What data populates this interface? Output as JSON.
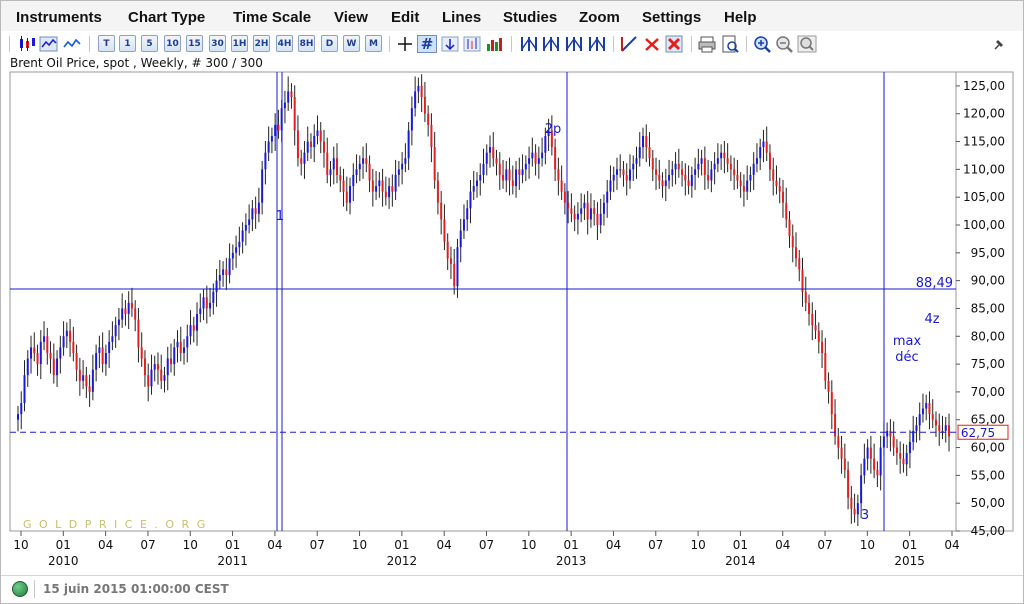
{
  "menu": [
    "Instruments",
    "Chart Type",
    "Time Scale",
    "View",
    "Edit",
    "Lines",
    "Studies",
    "Zoom",
    "Settings",
    "Help"
  ],
  "toolbar": {
    "chart_type_icons": [
      "candlestick-icon",
      "bar-chart-icon",
      "line-chart-icon"
    ],
    "timescale_buttons": [
      "T",
      "1",
      "5",
      "10",
      "15",
      "30",
      "1H",
      "2H",
      "4H",
      "8H",
      "D",
      "W",
      "M"
    ],
    "tool_icons": [
      "crosshair-icon",
      "grid-icon",
      "arrow-down-icon",
      "volume-icon",
      "histogram-icon",
      "cycle-lines-icon-1",
      "cycle-lines-icon-2",
      "cycle-lines-icon-3",
      "cycle-lines-icon-4",
      "draw-line-icon",
      "delete-line-icon",
      "delete-all-icon",
      "print-icon",
      "print-preview-icon",
      "zoom-in-icon",
      "zoom-out-icon",
      "zoom-reset-icon",
      "pin-icon"
    ]
  },
  "chart": {
    "subtitle": "Brent Oil Price, spot , Weekly, # 300 / 300",
    "watermark": "G O L D P R I C E . O R G",
    "annotations": [
      {
        "text": "2p",
        "color": "#1a1ad6"
      },
      {
        "text": "1",
        "color": "#1a1ad6"
      },
      {
        "text": "4z",
        "color": "#1a1ad6"
      },
      {
        "text": "max",
        "color": "#1a1ad6"
      },
      {
        "text": "déc",
        "color": "#1a1ad6"
      },
      {
        "text": "3",
        "color": "#1a1ad6"
      }
    ],
    "hline_label": "88,49",
    "last_price": "62,75"
  },
  "status": {
    "text": "15 juin 2015 01:00:00 CEST"
  },
  "chart_data": {
    "type": "bar",
    "series_name": "",
    "y_axis_side": "right",
    "ylim": [
      45,
      127.5
    ],
    "y_ticks": [
      "45,00",
      "50,00",
      "55,00",
      "60,00",
      "65,00",
      "70,00",
      "75,00",
      "80,00",
      "85,00",
      "90,00",
      "95,00",
      "100,00",
      "105,00",
      "110,00",
      "115,00",
      "120,00",
      "125,00"
    ],
    "x_month_ticks": [
      "10",
      "01",
      "04",
      "07",
      "10",
      "01",
      "04",
      "07",
      "10",
      "01",
      "04",
      "07",
      "10",
      "01",
      "04",
      "07",
      "10",
      "01",
      "04",
      "07",
      "10",
      "01",
      "04"
    ],
    "x_year_labels": [
      "2010",
      "2011",
      "2012",
      "2013",
      "2014",
      "2015"
    ],
    "up_color": "#1a1ad6",
    "down_color": "#e02020",
    "wick_color": "#222222",
    "horizontal_line": {
      "value": 88.49,
      "color": "#1a1ad6",
      "style": "solid"
    },
    "last_price_line": {
      "value": 62.75,
      "color": "#1a1ad6",
      "style": "dashed"
    },
    "vertical_markers": [
      "2011-05 (1)",
      "2011-05",
      "2013-02 (2p)",
      "2015-01 (3)"
    ],
    "weekly_closes": [
      66,
      68,
      73,
      76,
      78,
      77,
      75,
      79,
      80,
      77,
      76,
      73,
      76,
      78,
      80,
      81,
      79,
      77,
      74,
      72,
      73,
      71,
      70,
      74,
      77,
      78,
      75,
      77,
      79,
      80,
      82,
      83,
      85,
      84,
      86,
      85,
      83,
      78,
      76,
      73,
      71,
      74,
      75,
      74,
      72,
      73,
      76,
      75,
      78,
      79,
      77,
      78,
      80,
      82,
      81,
      84,
      85,
      87,
      85,
      86,
      88,
      90,
      91,
      92,
      91,
      94,
      95,
      96,
      97,
      99,
      100,
      101,
      103,
      102,
      104,
      110,
      113,
      115,
      116,
      118,
      117,
      121,
      122,
      124,
      123,
      117,
      112,
      111,
      113,
      115,
      114,
      116,
      117,
      115,
      113,
      109,
      110,
      112,
      109,
      108,
      106,
      104,
      107,
      109,
      110,
      111,
      112,
      111,
      108,
      106,
      107,
      108,
      106,
      105,
      107,
      106,
      109,
      110,
      111,
      112,
      117,
      121,
      124,
      125,
      123,
      120,
      118,
      114,
      108,
      104,
      101,
      97,
      94,
      93,
      89,
      96,
      99,
      101,
      103,
      106,
      107,
      108,
      109,
      111,
      113,
      114,
      112,
      111,
      109,
      108,
      110,
      108,
      107,
      110,
      109,
      110,
      111,
      112,
      113,
      111,
      112,
      113,
      116,
      117,
      114,
      110,
      108,
      106,
      104,
      103,
      102,
      101,
      102,
      103,
      104,
      101,
      103,
      102,
      100,
      102,
      104,
      106,
      108,
      109,
      110,
      110,
      109,
      108,
      110,
      111,
      112,
      114,
      116,
      114,
      112,
      110,
      109,
      108,
      107,
      108,
      109,
      110,
      111,
      110,
      109,
      108,
      107,
      109,
      110,
      111,
      112,
      109,
      108,
      110,
      111,
      112,
      113,
      112,
      111,
      110,
      109,
      108,
      107,
      106,
      108,
      109,
      111,
      112,
      114,
      115,
      113,
      110,
      108,
      107,
      106,
      104,
      101,
      98,
      96,
      94,
      92,
      88,
      86,
      84,
      82,
      81,
      79,
      77,
      72,
      70,
      66,
      62,
      60,
      58,
      56,
      51,
      49,
      48,
      50,
      55,
      58,
      60,
      58,
      56,
      55,
      60,
      62,
      63,
      62,
      60,
      59,
      58,
      57,
      59,
      61,
      63,
      64,
      66,
      67,
      68,
      66,
      65,
      64,
      63,
      63,
      64,
      62
    ]
  }
}
